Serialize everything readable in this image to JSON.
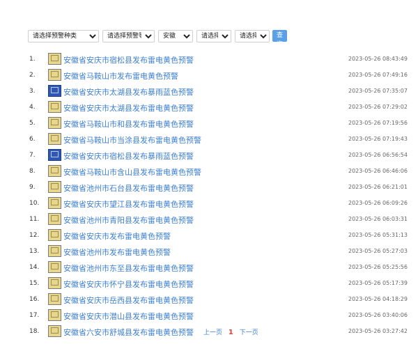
{
  "filters": {
    "warning_type": "请选择预警种类",
    "warning_level": "请选择预警等级",
    "province": "安徽",
    "city": "请选择市",
    "county": "请选择县",
    "query_label": "查询"
  },
  "items": [
    {
      "index": "1.",
      "title": "安徽省安庆市宿松县发布雷电黄色预警",
      "time": "2023-05-26 08:43:49",
      "icon": "lightning-yellow-icon",
      "color": "yellow"
    },
    {
      "index": "2.",
      "title": "安徽省马鞍山市发布雷电黄色预警",
      "time": "2023-05-26 07:49:16",
      "icon": "lightning-yellow-icon",
      "color": "yellow"
    },
    {
      "index": "3.",
      "title": "安徽省安庆市太湖县发布暴雨蓝色预警",
      "time": "2023-05-26 07:35:07",
      "icon": "rainstorm-blue-icon",
      "color": "blue"
    },
    {
      "index": "4.",
      "title": "安徽省安庆市太湖县发布雷电黄色预警",
      "time": "2023-05-26 07:29:02",
      "icon": "lightning-yellow-icon",
      "color": "yellow"
    },
    {
      "index": "5.",
      "title": "安徽省马鞍山市和县发布雷电黄色预警",
      "time": "2023-05-26 07:19:56",
      "icon": "lightning-yellow-icon",
      "color": "yellow"
    },
    {
      "index": "6.",
      "title": "安徽省马鞍山市当涂县发布雷电黄色预警",
      "time": "2023-05-26 07:19:43",
      "icon": "lightning-yellow-icon",
      "color": "yellow"
    },
    {
      "index": "7.",
      "title": "安徽省安庆市宿松县发布暴雨蓝色预警",
      "time": "2023-05-26 06:56:54",
      "icon": "rainstorm-blue-icon",
      "color": "blue"
    },
    {
      "index": "8.",
      "title": "安徽省马鞍山市含山县发布雷电黄色预警",
      "time": "2023-05-26 06:46:06",
      "icon": "lightning-yellow-icon",
      "color": "yellow"
    },
    {
      "index": "9.",
      "title": "安徽省池州市石台县发布雷电黄色预警",
      "time": "2023-05-26 06:21:01",
      "icon": "lightning-yellow-icon",
      "color": "yellow"
    },
    {
      "index": "10.",
      "title": "安徽省安庆市望江县发布雷电黄色预警",
      "time": "2023-05-26 06:09:26",
      "icon": "lightning-yellow-icon",
      "color": "yellow"
    },
    {
      "index": "11.",
      "title": "安徽省池州市青阳县发布雷电黄色预警",
      "time": "2023-05-26 06:03:31",
      "icon": "lightning-yellow-icon",
      "color": "yellow"
    },
    {
      "index": "12.",
      "title": "安徽省安庆市发布雷电黄色预警",
      "time": "2023-05-26 05:31:13",
      "icon": "lightning-yellow-icon",
      "color": "yellow"
    },
    {
      "index": "13.",
      "title": "安徽省池州市发布雷电黄色预警",
      "time": "2023-05-26 05:27:03",
      "icon": "lightning-yellow-icon",
      "color": "yellow"
    },
    {
      "index": "14.",
      "title": "安徽省池州市东至县发布雷电黄色预警",
      "time": "2023-05-26 05:25:56",
      "icon": "lightning-yellow-icon",
      "color": "yellow"
    },
    {
      "index": "15.",
      "title": "安徽省安庆市怀宁县发布雷电黄色预警",
      "time": "2023-05-26 05:17:39",
      "icon": "lightning-yellow-icon",
      "color": "yellow"
    },
    {
      "index": "16.",
      "title": "安徽省安庆市岳西县发布雷电黄色预警",
      "time": "2023-05-26 04:18:29",
      "icon": "lightning-yellow-icon",
      "color": "yellow"
    },
    {
      "index": "17.",
      "title": "安徽省安庆市潜山县发布雷电黄色预警",
      "time": "2023-05-26 03:40:06",
      "icon": "lightning-yellow-icon",
      "color": "yellow"
    },
    {
      "index": "18.",
      "title": "安徽省六安市舒城县发布雷电黄色预警",
      "time": "2023-05-26 03:27:42",
      "icon": "lightning-yellow-icon",
      "color": "yellow"
    }
  ],
  "pager": {
    "prev_label": "上一页",
    "current_page": "1",
    "next_label": "下一页"
  },
  "colors": {
    "link": "#3d7fd0",
    "button": "#5aa0e8",
    "current_page": "#e03c3c",
    "icon_yellow": "#e8d68a",
    "icon_blue": "#2f57b8"
  }
}
